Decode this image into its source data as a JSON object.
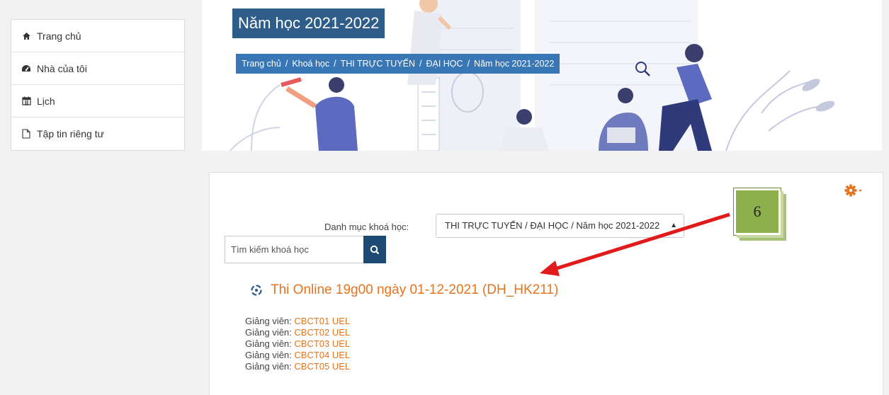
{
  "sidebar": {
    "items": [
      {
        "label": "Trang chủ",
        "icon": "home-icon"
      },
      {
        "label": "Nhà của tôi",
        "icon": "dashboard-icon"
      },
      {
        "label": "Lịch",
        "icon": "calendar-icon"
      },
      {
        "label": "Tập tin riêng tư",
        "icon": "file-icon"
      }
    ]
  },
  "header": {
    "title": "Năm học 2021-2022",
    "breadcrumb": [
      "Trang chủ",
      "Khoá học",
      "THI TRỰC TUYẾN",
      "ĐẠI HỌC",
      "Năm học 2021-2022"
    ],
    "separator": "/"
  },
  "main": {
    "category_label": "Danh mục khoá học:",
    "category_value": "THI TRỰC TUYẾN / ĐẠI HỌC / Năm học 2021-2022",
    "search_placeholder": "Tìm kiếm khoá học",
    "course_title": "Thi Online 19g00 ngày 01-12-2021 (DH_HK211)",
    "teacher_prefix": "Giảng viên:",
    "teachers": [
      "CBCT01 UEL",
      "CBCT02 UEL",
      "CBCT03 UEL",
      "CBCT04 UEL",
      "CBCT05 UEL"
    ]
  },
  "annotation": {
    "step_number": "6"
  },
  "colors": {
    "accent": "#e8731d",
    "title_bg": "#2f5d8a",
    "breadcrumb_bg": "#3976b5",
    "search_btn": "#1c4a73",
    "arrow": "#e11b1b",
    "badge": "#8db04d"
  }
}
